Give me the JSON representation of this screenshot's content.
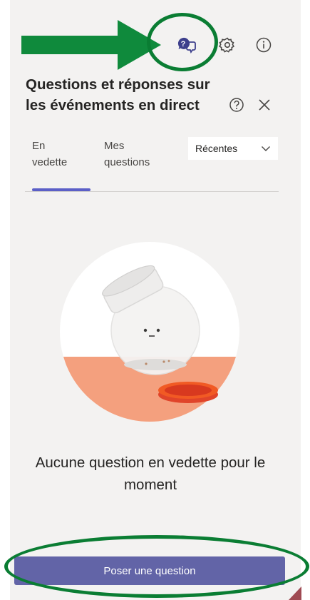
{
  "header": {
    "title": "Questions et réponses sur les événements en direct"
  },
  "tabs": [
    {
      "label": "En vedette",
      "selected": true
    },
    {
      "label": "Mes questions",
      "selected": false
    }
  ],
  "sort": {
    "selected": "Récentes"
  },
  "empty_state": {
    "message": "Aucune question en vedette pour le moment"
  },
  "actions": {
    "ask_label": "Poser une question"
  },
  "icons": {
    "qa": "qa-chat-icon",
    "settings": "gear-icon",
    "info": "info-icon",
    "help": "help-icon",
    "close": "close-icon",
    "sort": "chevron-down-icon"
  },
  "colors": {
    "panel_bg": "#f3f2f1",
    "accent": "#6264a7",
    "tab_indicator": "#5b5fc7",
    "annotation_green": "#0a7d33",
    "arrow_green": "#0f8a3c"
  }
}
